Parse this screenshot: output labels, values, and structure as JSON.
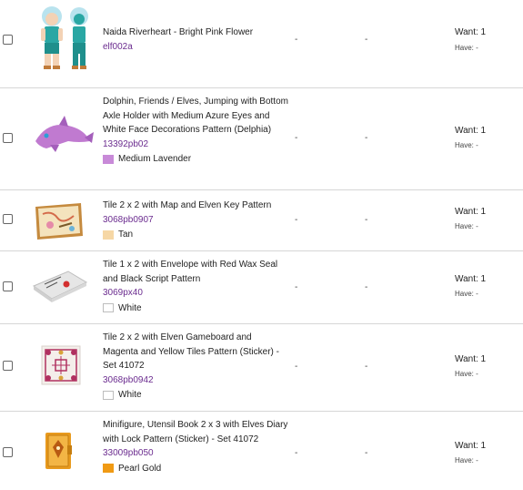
{
  "items": [
    {
      "name": "Naida Riverheart - Bright Pink Flower",
      "part": "elf002a",
      "color_name": "",
      "color": "",
      "dash1": "-",
      "dash2": "-",
      "want": "Want: 1",
      "have": "Have: -"
    },
    {
      "name": "Dolphin, Friends / Elves, Jumping with Bottom Axle Holder with Medium Azure Eyes and White Face Decorations Pattern (Delphia)",
      "part": "13392pb02",
      "color_name": "Medium Lavender",
      "color": "#c88ad8",
      "dash1": "-",
      "dash2": "-",
      "want": "Want: 1",
      "have": "Have: -"
    },
    {
      "name": "Tile 2 x 2 with Map and Elven Key Pattern",
      "part": "3068pb0907",
      "color_name": "Tan",
      "color": "#f6d7a5",
      "dash1": "-",
      "dash2": "-",
      "want": "Want: 1",
      "have": "Have: -"
    },
    {
      "name": "Tile 1 x 2 with Envelope with Red Wax Seal and Black Script Pattern",
      "part": "3069px40",
      "color_name": "White",
      "color": "#ffffff",
      "dash1": "-",
      "dash2": "-",
      "want": "Want: 1",
      "have": "Have: -"
    },
    {
      "name": "Tile 2 x 2 with Elven Gameboard and Magenta and Yellow Tiles Pattern (Sticker) - Set 41072",
      "part": "3068pb0942",
      "color_name": "White",
      "color": "#ffffff",
      "dash1": "-",
      "dash2": "-",
      "want": "Want: 1",
      "have": "Have: -"
    },
    {
      "name": "Minifigure, Utensil Book 2 x 3 with Elves Diary with Lock Pattern (Sticker) - Set 41072",
      "part": "33009pb050",
      "color_name": "Pearl Gold",
      "color": "#f09a14",
      "dash1": "-",
      "dash2": "-",
      "want": "Want: 1",
      "have": "Have: -"
    }
  ]
}
